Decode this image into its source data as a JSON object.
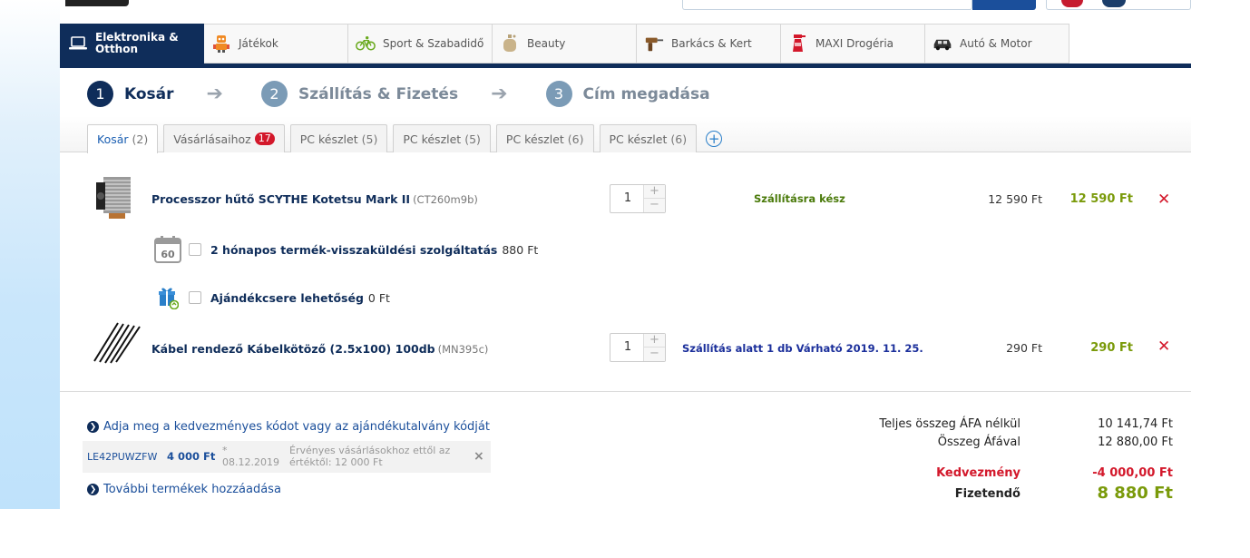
{
  "categories": [
    {
      "label": "Elektronika & Otthon",
      "icon": "laptop-icon",
      "active": true
    },
    {
      "label": "Játékok",
      "icon": "robot-toy-icon"
    },
    {
      "label": "Sport & Szabadidő",
      "icon": "bicycle-icon"
    },
    {
      "label": "Beauty",
      "icon": "perfume-icon"
    },
    {
      "label": "Barkács & Kert",
      "icon": "drill-icon"
    },
    {
      "label": "MAXI Drogéria",
      "icon": "spray-bottle-icon"
    },
    {
      "label": "Autó & Motor",
      "icon": "car-icon"
    }
  ],
  "steps": [
    {
      "num": "1",
      "label": "Kosár"
    },
    {
      "num": "2",
      "label": "Szállítás & Fizetés"
    },
    {
      "num": "3",
      "label": "Cím megadása"
    }
  ],
  "tabs": [
    {
      "label": "Kosár",
      "count": "(2)"
    },
    {
      "label": "Vásárlásaihoz",
      "badge": "17"
    },
    {
      "label": "PC készlet",
      "count": "(5)"
    },
    {
      "label": "PC készlet",
      "count": "(5)"
    },
    {
      "label": "PC készlet",
      "count": "(6)"
    },
    {
      "label": "PC készlet",
      "count": "(6)"
    }
  ],
  "items": [
    {
      "name": "Processzor hűtő SCYTHE Kotetsu Mark II",
      "code": "(CT260m9b)",
      "qty": "1",
      "status": "Szállításra kész",
      "price": "12 590 Ft",
      "total": "12 590 Ft"
    },
    {
      "name": "Kábel rendező Kábelkötöző (2.5x100) 100db",
      "code": "(MN395c)",
      "qty": "1",
      "status": "Szállítás alatt 1 db Várható 2019. 11. 25.",
      "price": "290 Ft",
      "total": "290 Ft"
    }
  ],
  "services": [
    {
      "name": "2 hónapos termék-visszaküldési szolgáltatás",
      "price": "880 Ft",
      "icon_text": "60"
    },
    {
      "name": "Ajándékcsere lehetőség",
      "price": "0 Ft"
    }
  ],
  "coupon_link": "Adja meg a kedvezményes kódot vagy az ajándékutalvány kódját",
  "coupon": {
    "code": "LE42PUWZFW",
    "amount": "4 000 Ft",
    "star": "*",
    "date": "08.12.2019",
    "note": "Érvényes vásárlásokhoz ettől az értéktől: 12 000 Ft",
    "remove": "×"
  },
  "more_link": "További termékek hozzáadása",
  "summary": {
    "net_label": "Teljes összeg ÁFA nélkül",
    "net_value": "10 141,74 Ft",
    "gross_label": "Összeg Áfával",
    "gross_value": "12 880,00 Ft",
    "discount_label": "Kedvezmény",
    "discount_value": "-4 000,00 Ft",
    "pay_label": "Fizetendő",
    "pay_value": "8 880 Ft"
  },
  "colors": {
    "navy": "#0f2d5a",
    "price_green": "#7a9a0a",
    "status_green": "#4a7a0a",
    "status_blue": "#1b2f9b",
    "red": "#d3182b"
  }
}
